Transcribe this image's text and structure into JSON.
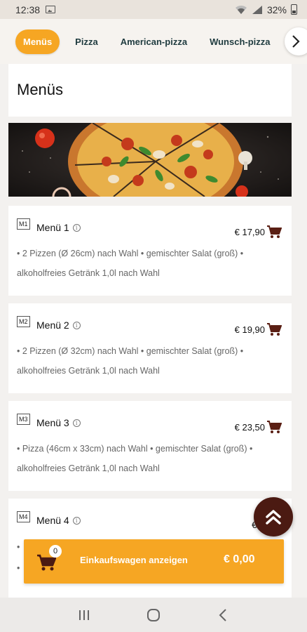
{
  "status": {
    "time": "12:38",
    "battery": "32%"
  },
  "nav": {
    "categories": [
      "Menüs",
      "Pizza",
      "American-pizza",
      "Wunsch-pizza"
    ],
    "active_index": 0
  },
  "page_title": "Menüs",
  "menus": [
    {
      "code": "M1",
      "name": "Menü 1",
      "price": "€ 17,90",
      "desc": "• 2 Pizzen (Ø 26cm) nach Wahl • gemischter Salat (groß) • alkoholfreies Getränk 1,0l nach Wahl"
    },
    {
      "code": "M2",
      "name": "Menü 2",
      "price": "€ 19,90",
      "desc": "• 2 Pizzen (Ø 32cm) nach Wahl • gemischter Salat (groß) • alkoholfreies Getränk 1,0l nach Wahl"
    },
    {
      "code": "M3",
      "name": "Menü 3",
      "price": "€ 23,50",
      "desc": "• Pizza (46cm x 33cm) nach Wahl • gemischter Salat (groß) • alkoholfreies Getränk 1,0l nach Wahl"
    },
    {
      "code": "M4",
      "name": "Menü 4",
      "price": "€ 26,",
      "desc": "•\n•"
    }
  ],
  "cart": {
    "count": "0",
    "label": "Einkaufswagen anzeigen",
    "total": "€ 0,00"
  },
  "colors": {
    "accent": "#f6a623",
    "fab": "#4b1a12",
    "cart_icon": "#5a1f14"
  },
  "icons": [
    "image-icon",
    "wifi-icon",
    "signal-icon",
    "battery-icon",
    "chevron-right-icon",
    "info-icon",
    "cart-icon",
    "double-chevron-up-icon",
    "recents-icon",
    "home-icon",
    "back-icon"
  ]
}
